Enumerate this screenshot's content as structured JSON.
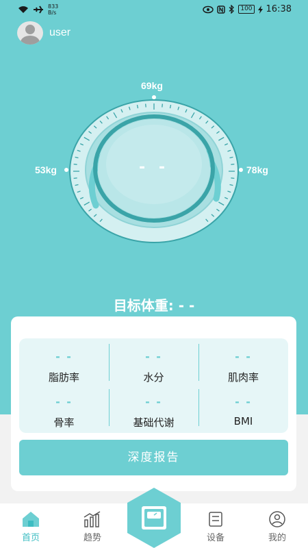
{
  "status_bar": {
    "net_speed_value": "833",
    "net_speed_unit": "B/s",
    "battery": "100",
    "time": "16:38"
  },
  "user": {
    "name": "user"
  },
  "gauge": {
    "top_label": "69kg",
    "left_label": "53kg",
    "right_label": "78kg",
    "current_value": "- -"
  },
  "target_weight": "目标体重: - -",
  "metrics": [
    {
      "value": "- -",
      "label": "脂肪率"
    },
    {
      "value": "- -",
      "label": "水分"
    },
    {
      "value": "- -",
      "label": "肌肉率"
    },
    {
      "value": "- -",
      "label": "骨率"
    },
    {
      "value": "- -",
      "label": "基础代谢"
    },
    {
      "value": "- -",
      "label": "BMI"
    }
  ],
  "report_button": "深度报告",
  "tabs": {
    "home": "首页",
    "trend": "趋势",
    "device": "设备",
    "mine": "我的"
  },
  "colors": {
    "accent": "#6dcfd2",
    "accent_dark": "#3aa4a8",
    "tab_active": "#3dbdc2"
  }
}
